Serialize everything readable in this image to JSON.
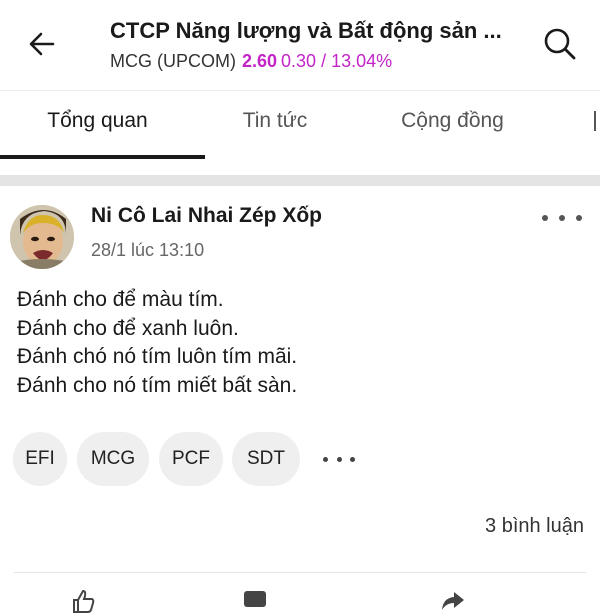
{
  "header": {
    "title": "CTCP Năng lượng và Bất động sản ...",
    "ticker": "MCG (UPCOM)",
    "price": "2.60",
    "change": "0.30 / 13.04%",
    "accent_color": "#c224c8",
    "back_icon": "arrow-left-icon",
    "search_icon": "search-icon"
  },
  "tabs": [
    {
      "label": "Tổng quan",
      "active": true
    },
    {
      "label": "Tin tức",
      "active": false
    },
    {
      "label": "Cộng đồng",
      "active": false
    }
  ],
  "post": {
    "author": "Ni Cô Lai Nhai Zép Xốp",
    "timestamp": "28/1 lúc 13:10",
    "lines": [
      "Đánh cho để màu tím.",
      "Đánh cho để xanh luôn.",
      "Đánh chó nó tím luôn tím mãi.",
      "Đánh cho nó tím miết bất sàn."
    ],
    "tags": [
      "EFI",
      "MCG",
      "PCF",
      "SDT"
    ],
    "comments": "3 bình luận"
  }
}
